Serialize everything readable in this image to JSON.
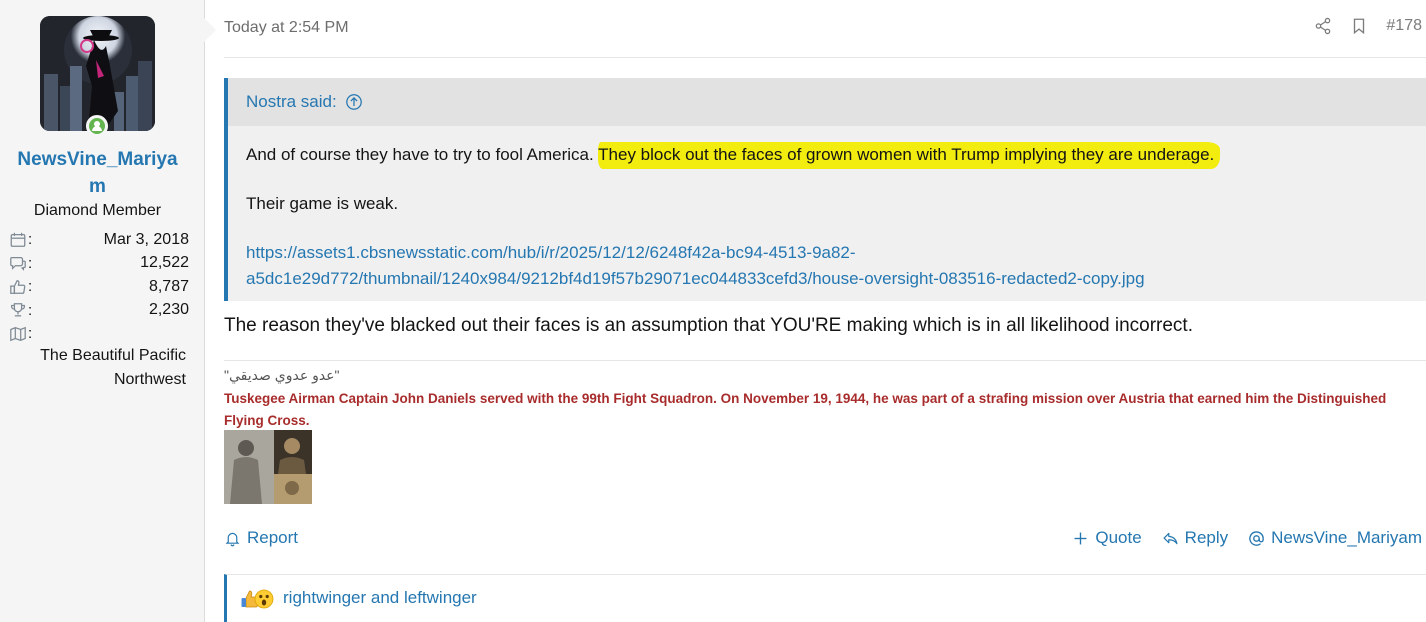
{
  "user": {
    "name": "NewsVine_Mariyam",
    "title": "Diamond Member",
    "stats": [
      {
        "icon": "calendar-icon",
        "label": ":",
        "value": "Mar 3, 2018"
      },
      {
        "icon": "messages-icon",
        "label": ":",
        "value": "12,522"
      },
      {
        "icon": "thumbs-up-icon",
        "label": ":",
        "value": "8,787"
      },
      {
        "icon": "trophy-icon",
        "label": ":",
        "value": "2,230"
      },
      {
        "icon": "map-icon",
        "label": ":",
        "value": ""
      }
    ],
    "location": "The Beautiful Pacific Northwest"
  },
  "post": {
    "date": "Today at 2:54 PM",
    "number": "#178",
    "quote": {
      "author": "Nostra said:",
      "line1_plain": "And of course they have to try to fool America. ",
      "line1_highlight": "They block out the faces of grown women with Trump implying they are underage.",
      "line2": "Their game is weak.",
      "link_line1": "https://assets1.cbsnewsstatic.com/hub/i/r/2025/12/12/6248f42a-bc94-4513-9a82-",
      "link_line2": "a5dc1e29d772/thumbnail/1240x984/9212bf4d19f57b29071ec044833cefd3/house-oversight-083516-redacted2-copy.jpg"
    },
    "body": "The reason they've blacked out their faces is an assumption that YOU'RE making which is in all likelihood incorrect."
  },
  "signature": {
    "quote": "\"عدو عدوي صديقي\"",
    "text": "Tuskegee Airman Captain John Daniels served with the 99th Fight Squadron. On November 19, 1944, he was part of a strafing mission over Austria that earned him the Distinguished Flying Cross."
  },
  "actions": {
    "report": "Report",
    "quote": "Quote",
    "reply": "Reply",
    "mention": "NewsVine_Mariyam"
  },
  "reactions": {
    "text": "rightwinger and leftwinger"
  },
  "colors": {
    "link": "#2577b1",
    "highlight": "#f2ec0f",
    "signature_red": "#a82c2c",
    "online": "#63b34f"
  }
}
